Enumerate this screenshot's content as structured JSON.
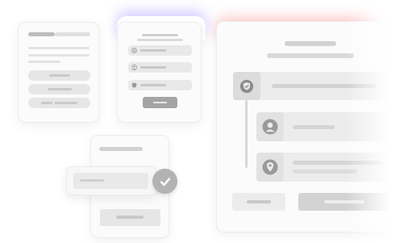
{
  "cards": {
    "list_card": {
      "tab_active": "",
      "tab_inactive": "",
      "buttons": [
        "",
        "",
        ""
      ]
    },
    "menu_card": {
      "items": [
        {
          "icon": "gear-icon"
        },
        {
          "icon": "user-icon"
        },
        {
          "icon": "shield-icon"
        }
      ]
    },
    "main_card": {
      "steps": [
        {
          "icon": "shield-check-icon",
          "active": true
        },
        {
          "icon": "user-icon",
          "active": false
        },
        {
          "icon": "location-pin-icon",
          "active": false
        }
      ]
    },
    "toast_card": {
      "status_icon": "check-circle-icon"
    }
  },
  "colors": {
    "accent_glow_purple": "#826eff",
    "accent_glow_red": "#ff7878",
    "neutral_bar": "#d8d8d8",
    "icon_gray": "#9a9a9a"
  }
}
